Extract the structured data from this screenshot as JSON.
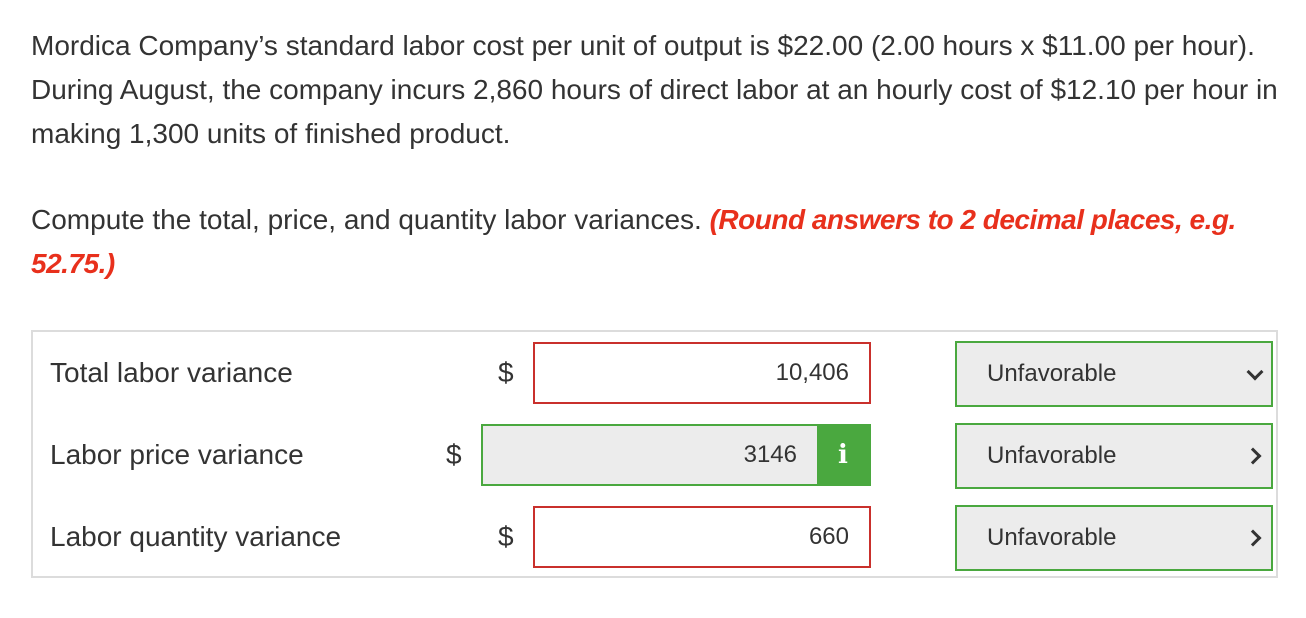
{
  "problem": {
    "text": "Mordica Company’s standard labor cost per unit of output is $22.00 (2.00 hours x $11.00 per hour). During August, the company incurs 2,860 hours of direct labor at an hourly cost of $12.10 per hour in making 1,300 units of finished product."
  },
  "instruction": {
    "text": "Compute the total, price, and quantity labor variances.",
    "hint": "(Round answers to 2 decimal places, e.g. 52.75.)"
  },
  "rows": [
    {
      "label": "Total labor variance",
      "currency": "$",
      "amount": "10,406",
      "selection": "Unfavorable"
    },
    {
      "label": "Labor price variance",
      "currency": "$",
      "amount": "3146",
      "info_icon": "i",
      "selection": "Unfavorable"
    },
    {
      "label": "Labor quantity variance",
      "currency": "$",
      "amount": "660",
      "selection": "Unfavorable"
    }
  ],
  "colors": {
    "error_border": "#c9302c",
    "correct_border": "#4aa83f",
    "hint_red": "#e8301c",
    "disabled_bg": "#ececec"
  }
}
